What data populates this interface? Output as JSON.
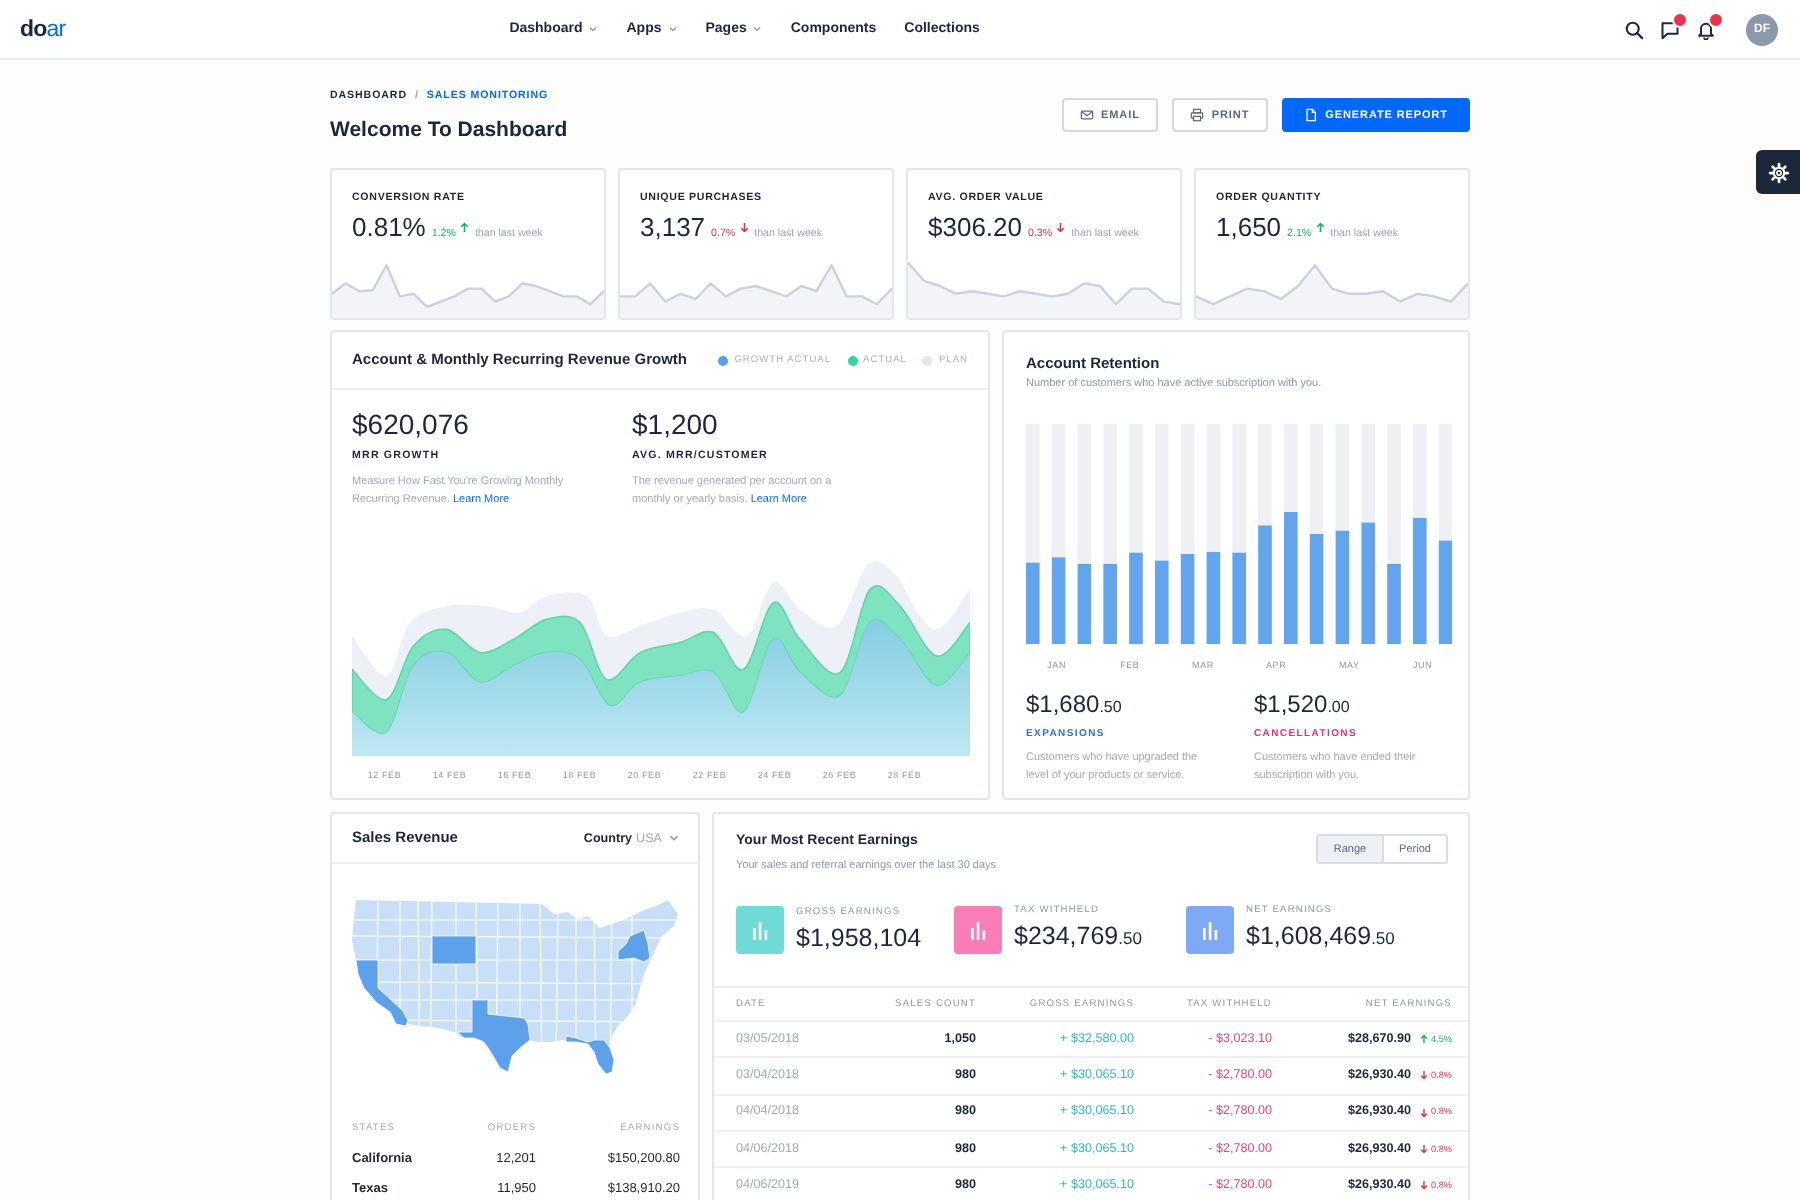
{
  "nav": {
    "logo": {
      "lead": "do",
      "accent": "ar"
    },
    "menu": [
      {
        "label": "Dashboard",
        "has_menu": true
      },
      {
        "label": "Apps",
        "has_menu": true
      },
      {
        "label": "Pages",
        "has_menu": true
      },
      {
        "label": "Components",
        "has_menu": false
      },
      {
        "label": "Collections",
        "has_menu": false
      }
    ],
    "messages_badge": true,
    "notifications_badge": true,
    "avatar": "DF"
  },
  "header": {
    "breadcrumb": [
      {
        "label": "DASHBOARD",
        "current": false
      },
      {
        "label": "SALES MONITORING",
        "current": true
      }
    ],
    "separator": "/",
    "title": "Welcome To Dashboard",
    "buttons": [
      {
        "label": "EMAIL",
        "kind": "email"
      },
      {
        "label": "PRINT",
        "kind": "print"
      },
      {
        "label": "GENERATE REPORT",
        "kind": "report"
      }
    ]
  },
  "kpis": [
    {
      "label": "CONVERSION RATE",
      "value": "0.81%",
      "change": "1.2%",
      "rising": true,
      "note": "than last week"
    },
    {
      "label": "UNIQUE PURCHASES",
      "value": "3,137",
      "change": "0.7%",
      "rising": false,
      "note": "than last week"
    },
    {
      "label": "AVG. ORDER VALUE",
      "value": "$306.20",
      "change": "0.3%",
      "rising": false,
      "note": "than last week"
    },
    {
      "label": "ORDER QUANTITY",
      "value": "1,650",
      "change": "2.1%",
      "rising": true,
      "note": "than last week"
    }
  ],
  "growth": {
    "title": "Account & Monthly Recurring Revenue Growth",
    "legend": [
      {
        "label": "GROWTH ACTUAL",
        "color": "#5b9fe8"
      },
      {
        "label": "ACTUAL",
        "color": "#3ad1a1"
      },
      {
        "label": "PLAN",
        "color": "#e3e7ef"
      }
    ],
    "stats": [
      {
        "value": "$620,076",
        "label": "MRR GROWTH",
        "text": "Measure How Fast You're Growing Monthly Recurring Revenue.",
        "link": "Learn More"
      },
      {
        "value": "$1,200",
        "label": "AVG. MRR/CUSTOMER",
        "text": "The revenue generated per account on a monthly or yearly basis.",
        "link": "Learn More"
      }
    ],
    "x_labels": [
      "12 FEB",
      "14 FEB",
      "16 FEB",
      "18 FEB",
      "20 FEB",
      "22 FEB",
      "24 FEB",
      "26 FEB",
      "28 FEB"
    ]
  },
  "retention": {
    "title": "Account Retention",
    "subtitle": "Number of customers who have active subscription with you.",
    "months": [
      "JAN",
      "FEB",
      "MAR",
      "APR",
      "MAY",
      "JUN"
    ],
    "stats": [
      {
        "value": "$1,680",
        "fraction": ".50",
        "label": "EXPANSIONS",
        "color": "#2f6fd6",
        "text": "Customers who have upgraded the level of your products or service."
      },
      {
        "value": "$1,520",
        "fraction": ".00",
        "label": "CANCELLATIONS",
        "color": "#e0307d",
        "text": "Customers who have ended their subscription with you."
      }
    ]
  },
  "sales_revenue": {
    "title": "Sales Revenue",
    "filter": {
      "label": "Country",
      "value": "USA"
    },
    "columns": [
      "STATES",
      "ORDERS",
      "EARNINGS"
    ],
    "rows": [
      {
        "state": "California",
        "orders": "12,201",
        "earnings": "$150,200.80"
      },
      {
        "state": "Texas",
        "orders": "11,950",
        "earnings": "$138,910.20"
      }
    ]
  },
  "earnings": {
    "title": "Your Most Recent Earnings",
    "subtitle": "Your sales and referral earnings over the last 30 days",
    "toggle": [
      {
        "label": "Range",
        "selected": true
      },
      {
        "label": "Period",
        "selected": false
      }
    ],
    "summary": [
      {
        "label": "GROSS EARNINGS",
        "value": "$1,958,104",
        "color": "#6fdad6"
      },
      {
        "label": "TAX WITHHELD",
        "value": "$234,769",
        "fraction": ".50",
        "color": "#f77eb9"
      },
      {
        "label": "NET EARNINGS",
        "value": "$1,608,469",
        "fraction": ".50",
        "color": "#7ea9f3"
      }
    ],
    "columns": [
      "DATE",
      "SALES COUNT",
      "GROSS EARNINGS",
      "TAX WITHHELD",
      "NET EARNINGS"
    ],
    "rows": [
      {
        "date": "03/05/2018",
        "count": "1,050",
        "gross": "+ $32,580.00",
        "tax": "- $3,023.10",
        "net": "$28,670.90",
        "change": "4.5%",
        "rising": true
      },
      {
        "date": "03/04/2018",
        "count": "980",
        "gross": "+ $30,065.10",
        "tax": "- $2,780.00",
        "net": "$26,930.40",
        "change": "0.8%",
        "rising": false
      },
      {
        "date": "04/04/2018",
        "count": "980",
        "gross": "+ $30,065.10",
        "tax": "- $2,780.00",
        "net": "$26,930.40",
        "change": "0.8%",
        "rising": false
      },
      {
        "date": "04/06/2018",
        "count": "980",
        "gross": "+ $30,065.10",
        "tax": "- $2,780.00",
        "net": "$26,930.40",
        "change": "0.8%",
        "rising": false
      },
      {
        "date": "04/06/2019",
        "count": "980",
        "gross": "+ $30,065.10",
        "tax": "- $2,780.00",
        "net": "$26,930.40",
        "change": "0.8%",
        "rising": false
      }
    ]
  }
}
